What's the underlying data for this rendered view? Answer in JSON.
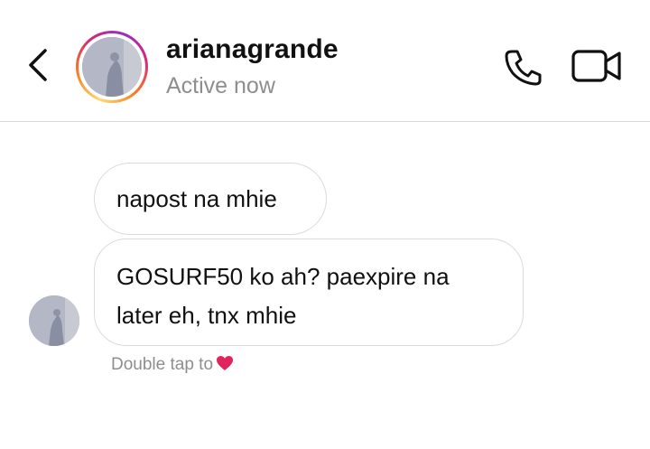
{
  "header": {
    "username": "arianagrande",
    "status": "Active now",
    "back_icon": "chevron-left-icon",
    "call_icon": "phone-icon",
    "video_icon": "video-camera-icon",
    "story_ring_colors": [
      "#feda75",
      "#fa7e1e",
      "#d62976",
      "#962fbf"
    ]
  },
  "messages": [
    {
      "text": "napost na mhie"
    },
    {
      "text": "GOSURF50 ko ah? paexpire na later eh, tnx mhie"
    }
  ],
  "hint": {
    "text": "Double tap to",
    "icon": "heart-icon",
    "icon_color": "#e0245e"
  },
  "colors": {
    "background": "#ffffff",
    "bubble_border": "#dbdbdb",
    "secondary_text": "#8e8e8e"
  }
}
